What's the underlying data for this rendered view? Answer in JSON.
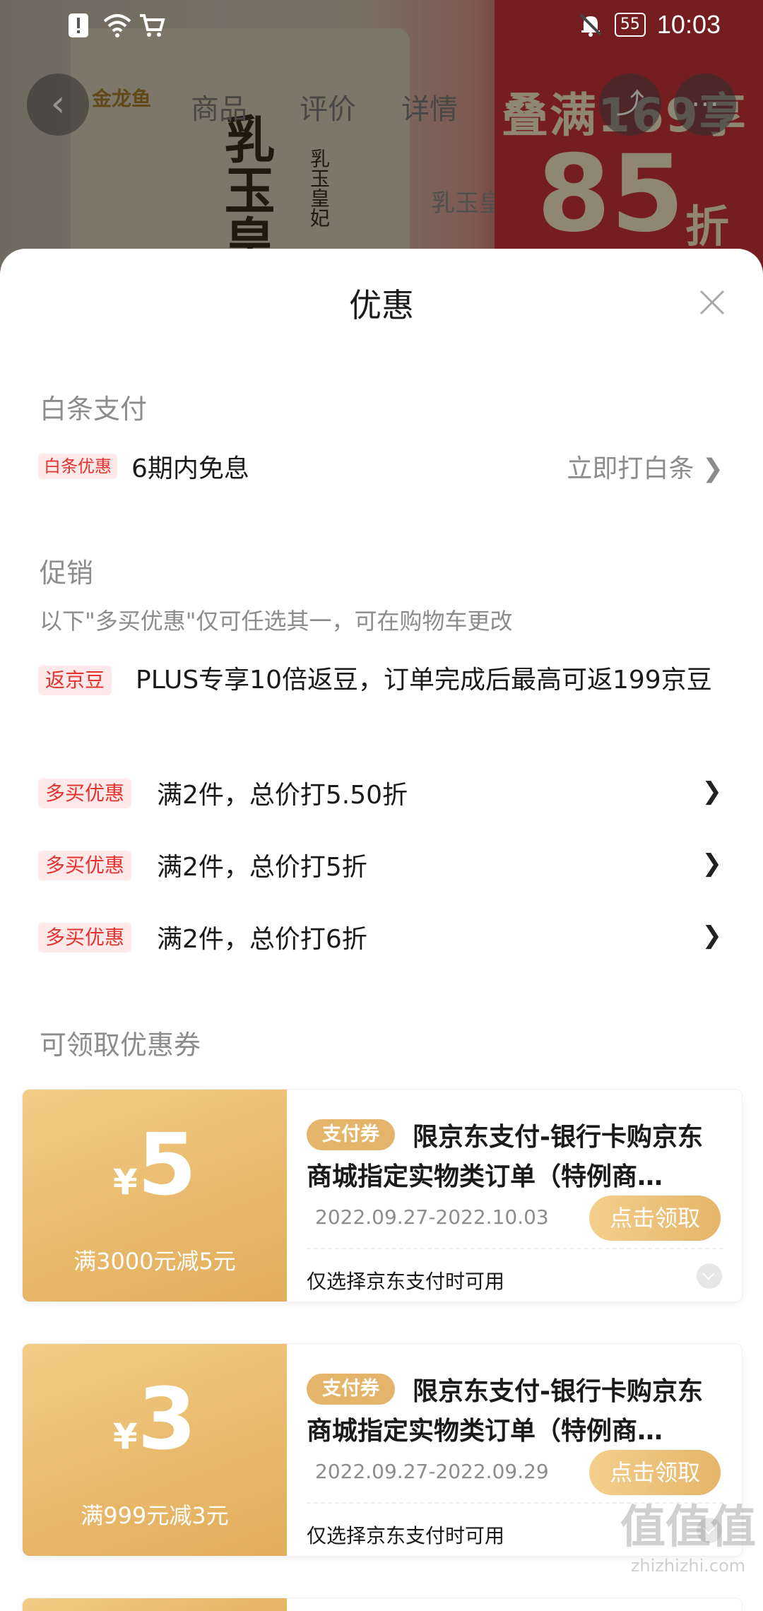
{
  "background": {
    "brand": "金龙鱼",
    "tabs": [
      "商品",
      "评价",
      "详情"
    ],
    "product_title": "乳玉皇",
    "product_sub": "乳玉皇妃",
    "middle_label": "乳玉皇妃",
    "promo_line1": "叠满169享",
    "promo_big": "85",
    "promo_unit": "折"
  },
  "status_bar": {
    "battery": "55",
    "time": "10:03"
  },
  "sheet": {
    "title": "优惠",
    "baitiao": {
      "section_title": "白条支付",
      "tag": "白条优惠",
      "text": "6期内免息",
      "action": "立即打白条 ❯"
    },
    "promo": {
      "section_title": "促销",
      "note": "以下\"多买优惠\"仅可任选其一，可在购物车更改",
      "items": [
        {
          "tag": "返京豆",
          "text": "PLUS专享10倍返豆，订单完成后最高可返199京豆"
        },
        {
          "tag": "多买优惠",
          "text": "满2件，总价打5.50折"
        },
        {
          "tag": "多买优惠",
          "text": "满2件，总价打5折"
        },
        {
          "tag": "多买优惠",
          "text": "满2件，总价打6折"
        }
      ],
      "chevron": "❯"
    },
    "coupons": {
      "section_title": "可领取优惠券",
      "items": [
        {
          "currency": "¥",
          "amount": "5",
          "condition": "满3000元减5元",
          "badge": "支付券",
          "title": "限京东支付-银行卡购京东商城指定实物类订单（特例商…",
          "date": "2022.09.27-2022.10.03",
          "button": "点击领取",
          "footer": "仅选择京东支付时可用"
        },
        {
          "currency": "¥",
          "amount": "3",
          "condition": "满999元减3元",
          "badge": "支付券",
          "title": "限京东支付-银行卡购京东商城指定实物类订单（特例商…",
          "date": "2022.09.27-2022.09.29",
          "button": "点击领取",
          "footer": "仅选择京东支付时可用"
        }
      ]
    }
  },
  "watermark": {
    "top": "值值值",
    "bottom": "zhizhizhi.com"
  },
  "colors": {
    "accent_red": "#e3342f",
    "coupon_gold": "#e6b56a",
    "muted_text": "#8c8c8c"
  }
}
